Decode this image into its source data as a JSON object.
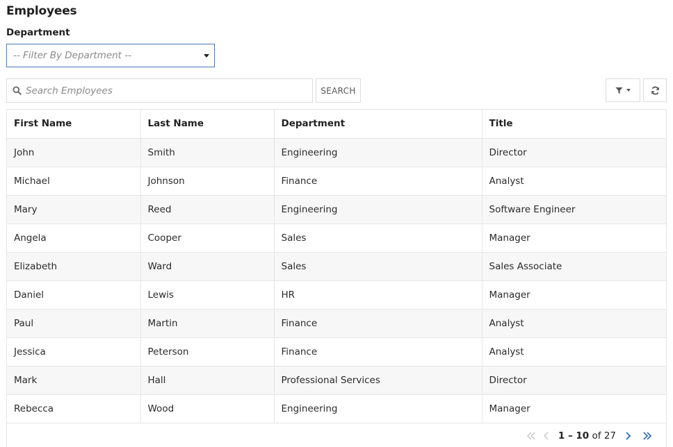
{
  "page": {
    "title": "Employees"
  },
  "filter": {
    "label": "Department",
    "placeholder": "-- Filter By Department --"
  },
  "search": {
    "placeholder": "Search Employees",
    "value": "",
    "button_label": "SEARCH"
  },
  "toolbar": {
    "filter_icon": "filter-icon",
    "refresh_icon": "refresh-icon"
  },
  "table": {
    "columns": [
      "First Name",
      "Last Name",
      "Department",
      "Title"
    ],
    "rows": [
      [
        "John",
        "Smith",
        "Engineering",
        "Director"
      ],
      [
        "Michael",
        "Johnson",
        "Finance",
        "Analyst"
      ],
      [
        "Mary",
        "Reed",
        "Engineering",
        "Software Engineer"
      ],
      [
        "Angela",
        "Cooper",
        "Sales",
        "Manager"
      ],
      [
        "Elizabeth",
        "Ward",
        "Sales",
        "Sales Associate"
      ],
      [
        "Daniel",
        "Lewis",
        "HR",
        "Manager"
      ],
      [
        "Paul",
        "Martin",
        "Finance",
        "Analyst"
      ],
      [
        "Jessica",
        "Peterson",
        "Finance",
        "Analyst"
      ],
      [
        "Mark",
        "Hall",
        "Professional Services",
        "Director"
      ],
      [
        "Rebecca",
        "Wood",
        "Engineering",
        "Manager"
      ]
    ]
  },
  "pagination": {
    "range": "1 – 10",
    "of_label": "of",
    "total": "27",
    "disabled_color": "#c4c4c4",
    "active_color": "#2f6db5"
  }
}
